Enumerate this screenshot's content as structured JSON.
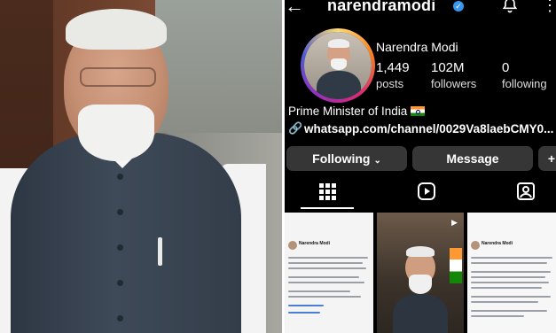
{
  "profile": {
    "username": "narendramodi",
    "display_name": "Narendra Modi",
    "stats": [
      {
        "value": "1,449",
        "label": "posts"
      },
      {
        "value": "102M",
        "label": "followers"
      },
      {
        "value": "0",
        "label": "following"
      }
    ],
    "bio": "Prime Minister of India",
    "link": "whatsapp.com/channel/0029Va8laebCMY0..."
  },
  "buttons": {
    "following": "Following",
    "message": "Message",
    "add": "+"
  },
  "icons": {
    "back": "back-arrow-icon",
    "verified": "verified-badge-icon",
    "bell": "bell-icon",
    "more": "more-vertical-icon",
    "link": "link-icon",
    "flag": "india-flag-icon",
    "tabs": [
      "grid-icon",
      "reels-icon",
      "tagged-icon"
    ]
  },
  "posts": [
    {
      "type": "text-post",
      "author": "Narendra Modi"
    },
    {
      "type": "video"
    },
    {
      "type": "text-post",
      "author": "Narendra Modi"
    }
  ],
  "colors": {
    "background": "#000000",
    "button_bg": "#363636",
    "verified": "#3897f0"
  }
}
